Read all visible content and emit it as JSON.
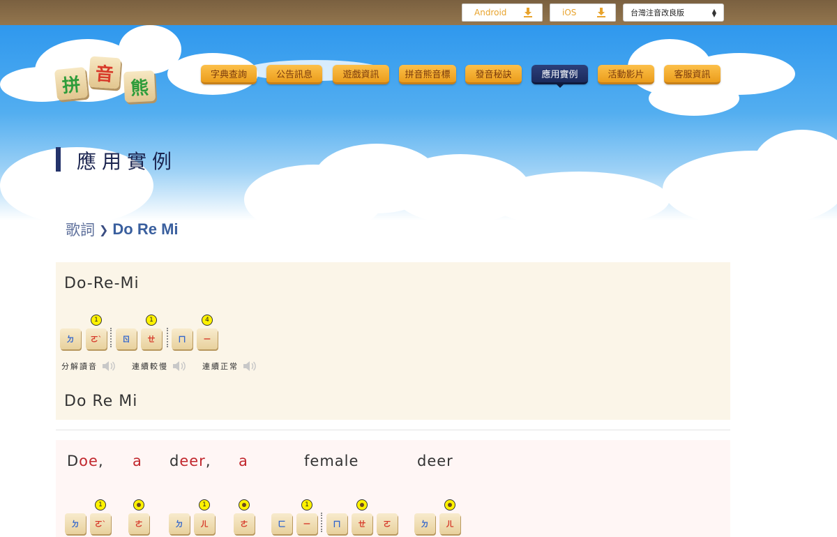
{
  "topbar": {
    "android_label": "Android",
    "ios_label": "iOS",
    "select_value": "台灣注音改良版"
  },
  "logo": {
    "chars": [
      "拼",
      "音",
      "熊"
    ]
  },
  "nav": [
    {
      "label": "字典查詢",
      "active": false
    },
    {
      "label": "公告訊息",
      "active": false
    },
    {
      "label": "遊戲資訊",
      "active": false
    },
    {
      "label": "拼音熊音標",
      "active": false
    },
    {
      "label": "發音秘訣",
      "active": false
    },
    {
      "label": "應用實例",
      "active": true
    },
    {
      "label": "活動影片",
      "active": false
    },
    {
      "label": "客服資訊",
      "active": false
    }
  ],
  "page_title": "應用實例",
  "breadcrumb": {
    "parent": "歌詞",
    "current": "Do Re Mi"
  },
  "song_title": "Do-Re-Mi",
  "song_title_plain": "Do Re Mi",
  "title_tiles": [
    {
      "sym": "ㄉ",
      "color": "blue",
      "tone": ""
    },
    {
      "sym": "ㄛˋ",
      "color": "red",
      "tone": "1"
    },
    {
      "sym": "ㄖ",
      "color": "blue",
      "tone": ""
    },
    {
      "sym": "ㄝ",
      "color": "red",
      "tone": "1"
    },
    {
      "sym": "ㄇ",
      "color": "blue",
      "tone": ""
    },
    {
      "sym": "ㄧ",
      "color": "red",
      "tone": "4"
    }
  ],
  "controls": [
    {
      "label": "分解讀音",
      "icon": "speaker-icon"
    },
    {
      "label": "連續較慢",
      "icon": "speaker-icon"
    },
    {
      "label": "連續正常",
      "icon": "speaker-icon"
    }
  ],
  "lyric_line": [
    {
      "pre": "D",
      "red": "oe",
      "post": ","
    },
    {
      "pre": "",
      "red": "a",
      "post": ""
    },
    {
      "pre": "d",
      "red": "eer",
      "post": ","
    },
    {
      "pre": "",
      "red": "a",
      "post": ""
    },
    {
      "pre": "f",
      "red": "",
      "post": "emale"
    },
    {
      "pre": "d",
      "red": "",
      "post": "eer"
    }
  ],
  "lyric_tiles": [
    {
      "sym": "ㄉ",
      "color": "blue",
      "tone": ""
    },
    {
      "sym": "ㄛˋ",
      "color": "red",
      "tone": "1"
    },
    {
      "sym": "ㄜ",
      "color": "red",
      "tone": "dot"
    },
    {
      "sym": "ㄉ",
      "color": "blue",
      "tone": ""
    },
    {
      "sym": "ㄦ",
      "color": "red",
      "tone": "1"
    },
    {
      "sym": "ㄜ",
      "color": "red",
      "tone": "dot"
    },
    {
      "sym": "ㄈ",
      "color": "blue",
      "tone": ""
    },
    {
      "sym": "ㄧ",
      "color": "red",
      "tone": "1"
    },
    {
      "sym": "ㄇ",
      "color": "blue",
      "tone": ""
    },
    {
      "sym": "ㄝ",
      "color": "red",
      "tone": "dot"
    },
    {
      "sym": "ㄛ",
      "color": "red",
      "tone": ""
    },
    {
      "sym": "ㄉ",
      "color": "blue",
      "tone": ""
    },
    {
      "sym": "ㄦ",
      "color": "red",
      "tone": "dot"
    }
  ]
}
